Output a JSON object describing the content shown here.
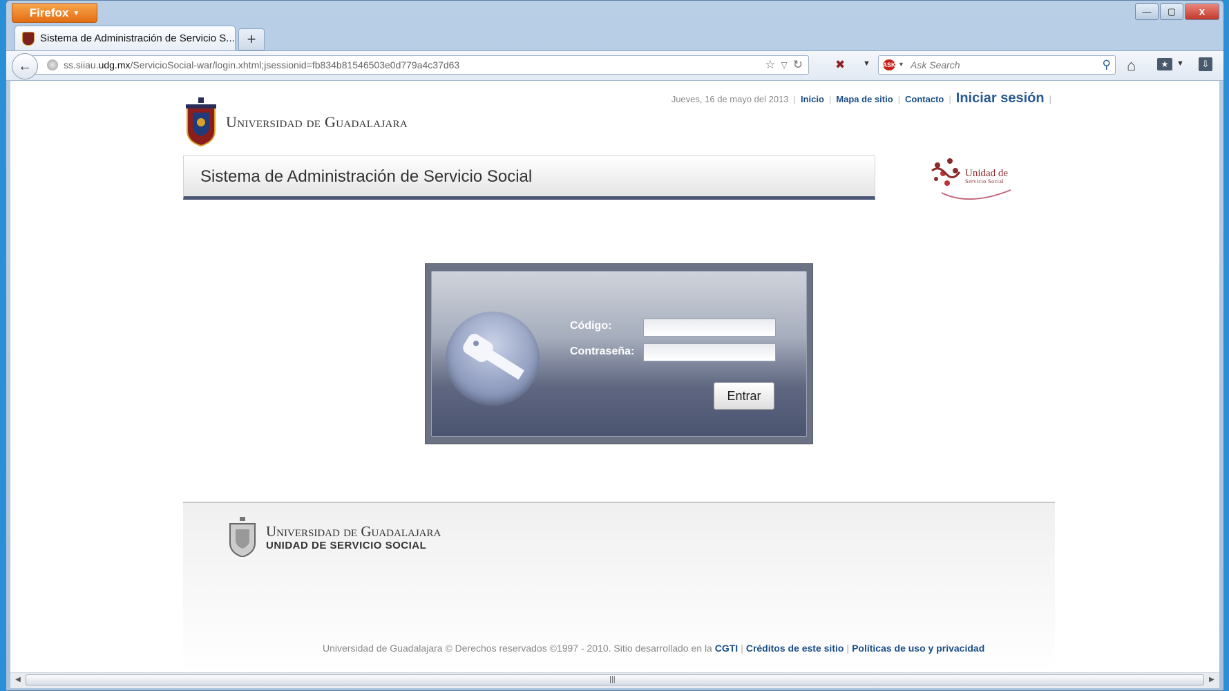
{
  "browser": {
    "menu_label": "Firefox",
    "tab_title": "Sistema de Administración de Servicio S...",
    "new_tab": "+",
    "url_prefix": "ss.siiau.",
    "url_domain": "udg.mx",
    "url_path": "/ServicioSocial-war/login.xhtml;jsessionid=fb834b81546503e0d779a4c37d63",
    "search_placeholder": "Ask Search",
    "ask_logo": "ASK",
    "window_controls": [
      "—",
      "▢",
      "X"
    ]
  },
  "header": {
    "date": "Jueves, 16 de mayo del 2013",
    "links": [
      "Inicio",
      "Mapa de sitio",
      "Contacto"
    ],
    "login_link": "Iniciar sesión",
    "university_name": "Universidad de Guadalajara",
    "banner_title": "Sistema de Administración de Servicio Social",
    "uss_logo_line1": "Unidad de",
    "uss_logo_line2": "Servicio Social"
  },
  "login": {
    "codigo_label": "Código:",
    "password_label": "Contraseña:",
    "codigo_value": "",
    "password_value": "",
    "submit_label": "Entrar"
  },
  "footer": {
    "university_name": "Universidad de Guadalajara",
    "unit_name": "UNIDAD DE SERVICIO SOCIAL",
    "copyright_text": "Universidad de Guadalajara © Derechos reservados ©1997 - 2010. Sitio desarrollado en la",
    "links": [
      "CGTI",
      "Créditos de este sitio",
      "Políticas de uso y privacidad"
    ]
  },
  "colors": {
    "link_blue": "#1b4e86",
    "banner_underline": "#4a5673",
    "firefox_orange": "#e36d12",
    "brand_maroon": "#8a2a2a"
  },
  "icons": [
    "back-arrow-icon",
    "globe-icon",
    "star-icon",
    "reload-icon",
    "addon-icon",
    "search-icon",
    "home-icon",
    "bookmarks-icon",
    "download-icon",
    "key-icon"
  ]
}
